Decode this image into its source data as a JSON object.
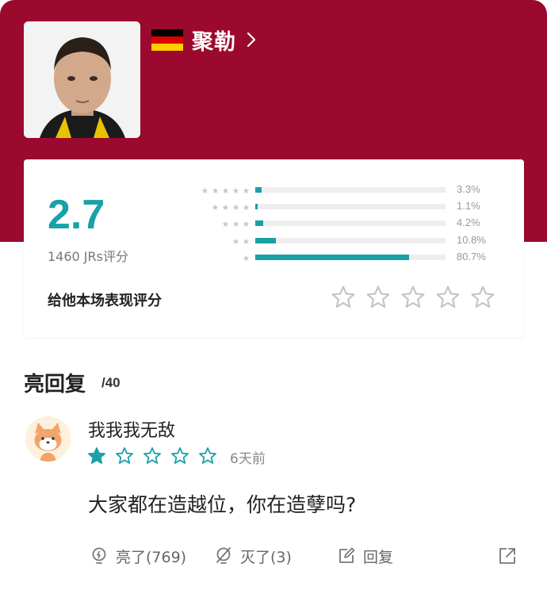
{
  "player": {
    "name": "聚勒",
    "flag_colors": [
      "#000000",
      "#dd0000",
      "#ffce00"
    ]
  },
  "rating": {
    "score": "2.7",
    "count_label": "1460 JRs评分",
    "distribution": [
      {
        "stars": 5,
        "percent_label": "3.3%",
        "fraction": 0.033
      },
      {
        "stars": 4,
        "percent_label": "1.1%",
        "fraction": 0.011
      },
      {
        "stars": 3,
        "percent_label": "4.2%",
        "fraction": 0.042
      },
      {
        "stars": 2,
        "percent_label": "10.8%",
        "fraction": 0.108
      },
      {
        "stars": 1,
        "percent_label": "80.7%",
        "fraction": 0.807
      }
    ],
    "rate_prompt": "给他本场表现评分",
    "rate_star_count": 5
  },
  "replies_section": {
    "title": "亮回复",
    "count": "/40"
  },
  "reply": {
    "username": "我我我无敌",
    "user_stars": 1,
    "user_stars_total": 5,
    "time": "6天前",
    "text": "大家都在造越位，你在造孽吗?",
    "actions": {
      "like_label": "亮了(769)",
      "dislike_label": "灭了(3)",
      "reply_label": "回复"
    }
  },
  "colors": {
    "header_bg": "#9b0a2e",
    "accent_teal": "#1aa0a8",
    "track_gray": "#eeeeee"
  }
}
